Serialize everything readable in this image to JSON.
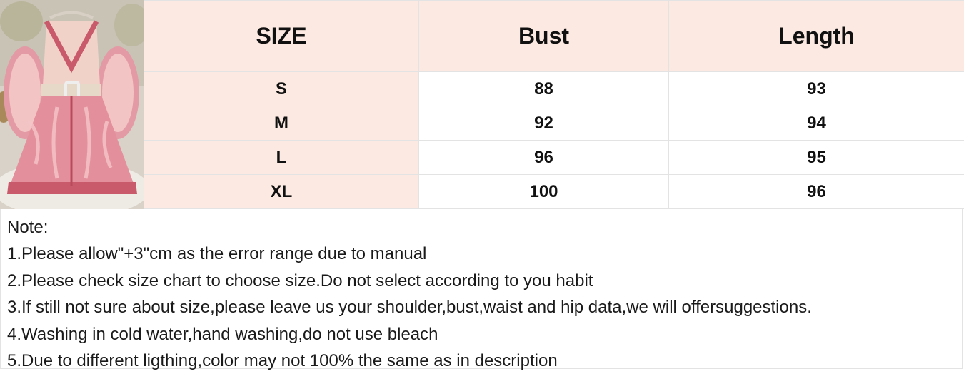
{
  "table": {
    "headers": [
      "SIZE",
      "Bust",
      "Length"
    ],
    "rows": [
      [
        "S",
        "88",
        "93"
      ],
      [
        "M",
        "92",
        "94"
      ],
      [
        "L",
        "96",
        "95"
      ],
      [
        "XL",
        "100",
        "96"
      ]
    ]
  },
  "notes": {
    "title": "Note:",
    "items": [
      "1.Please allow\"+3\"cm as the error range due to manual",
      "2.Please check size chart to choose size.Do not select according to you habit",
      "3.If still not sure about size,please leave us your shoulder,bust,waist and hip data,we will offersuggestions.",
      "4.Washing in cold water,hand washing,do not use bleach",
      "5.Due to different ligthing,color may not 100% the same as in description"
    ]
  },
  "colors": {
    "header_bg": "#fce9e1",
    "size_col_bg": "#fce9e1",
    "border": "#e3e3e3",
    "dress_pink": "#d9717f"
  }
}
